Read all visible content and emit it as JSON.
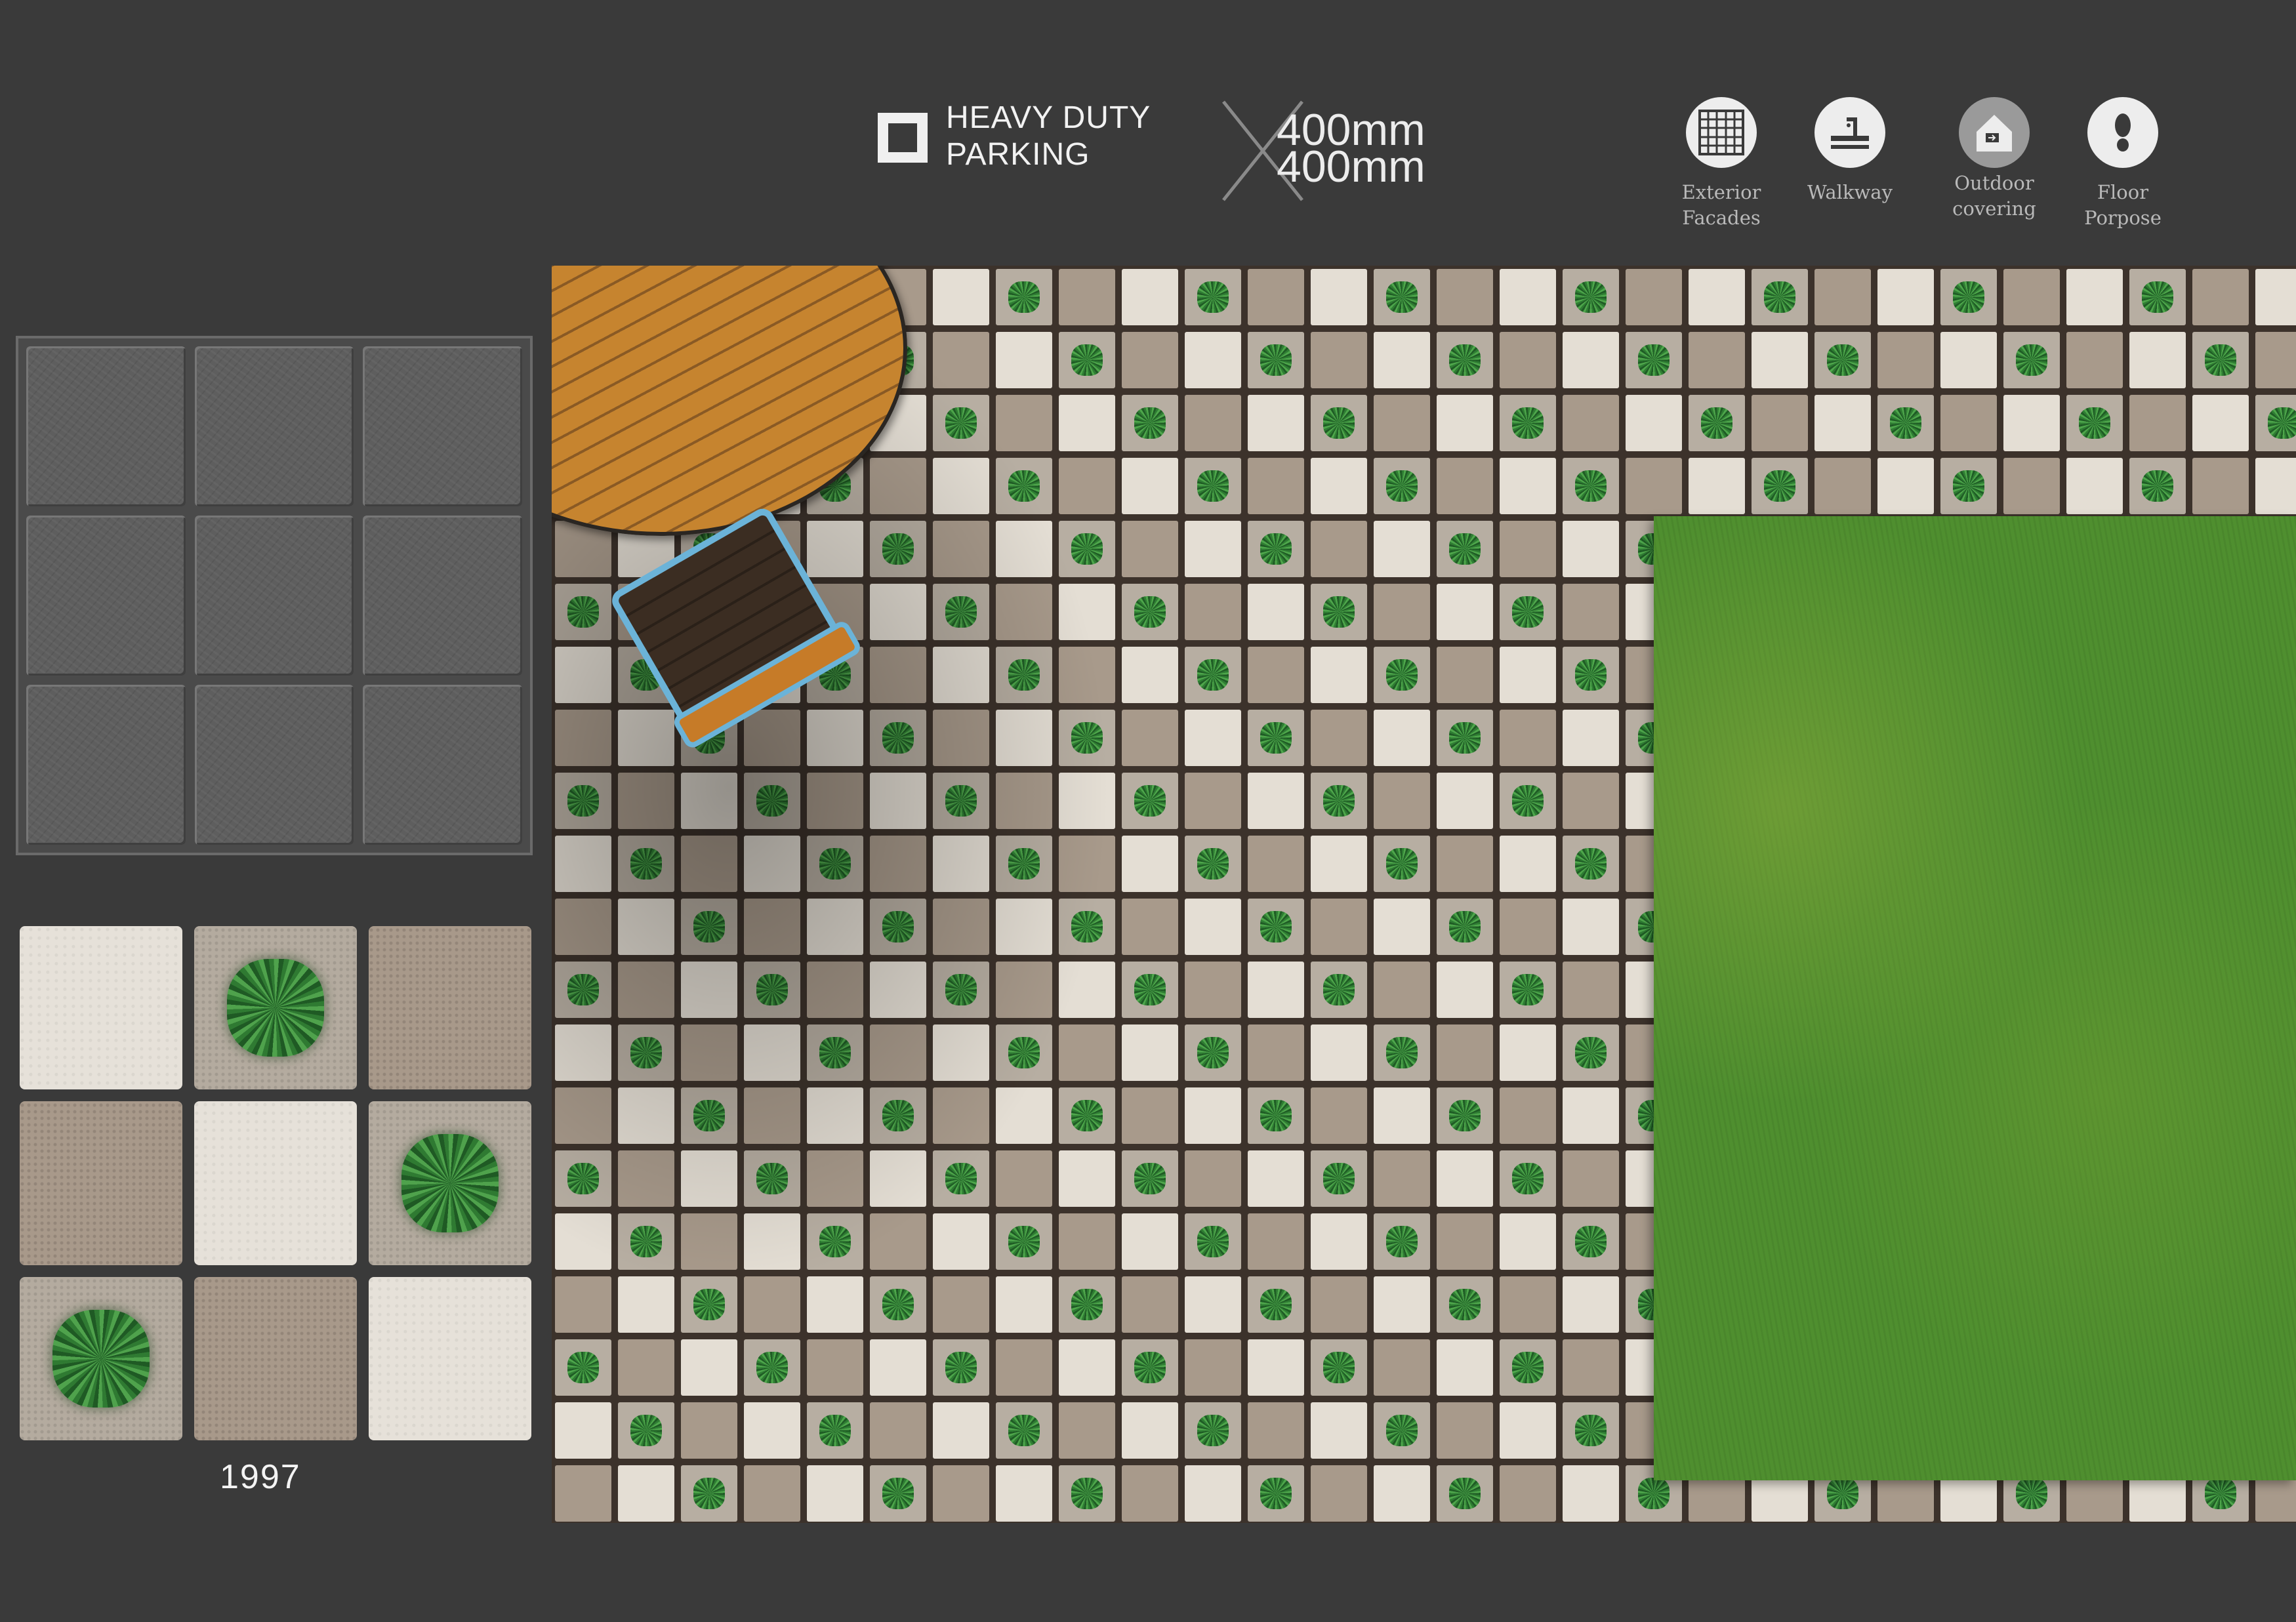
{
  "header": {
    "badge_line1": "HEAVY DUTY",
    "badge_line2": "PARKING",
    "size_line1": "400mm",
    "size_line2": "400mm"
  },
  "features": [
    {
      "icon": "grid-icon",
      "label_line1": "Exterior",
      "label_line2": "Facades"
    },
    {
      "icon": "walkway-icon",
      "label_line1": "Walkway",
      "label_line2": ""
    },
    {
      "icon": "outdoor-icon",
      "label_line1": "Outdoor",
      "label_line2": "covering"
    },
    {
      "icon": "footprint-icon",
      "label_line1": "Floor",
      "label_line2": "Porpose"
    }
  ],
  "tile": {
    "code": "1997"
  },
  "colors": {
    "background": "#3a3a3a",
    "tile_light": "#e4ded4",
    "tile_tan": "#a89a8b",
    "grass": "#4f8f2f",
    "chair_frame": "#6bb3d8"
  }
}
